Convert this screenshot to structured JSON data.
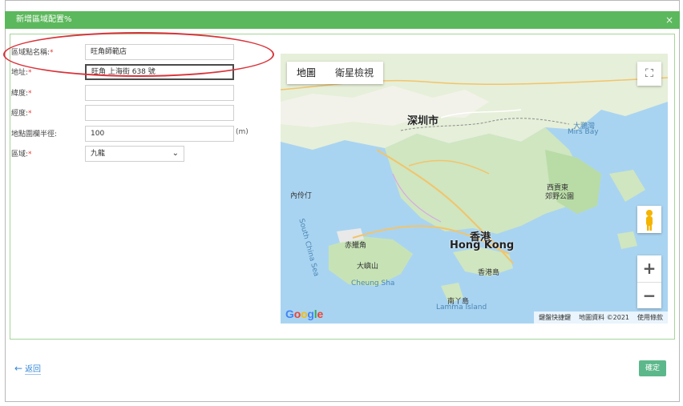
{
  "dialog": {
    "title": "新增區域配置%",
    "close_symbol": "×"
  },
  "form": {
    "name": {
      "label": "區域點名稱:",
      "value": "旺角師範店"
    },
    "address": {
      "label": "地址:",
      "value": "旺角 上海街 638 號"
    },
    "longitude": {
      "label": "緯度:",
      "value": ""
    },
    "latitude": {
      "label": "經度:",
      "value": ""
    },
    "radius": {
      "label": "地點圍欄半徑:",
      "value": "100",
      "unit": "(m)"
    },
    "region": {
      "label": "區域:",
      "value": "九龍"
    },
    "required_mark": "*"
  },
  "map": {
    "type_map": "地圖",
    "type_satellite": "衛星檢視",
    "fullscreen_symbol": "⛶",
    "zoom_in": "+",
    "zoom_out": "−",
    "labels": {
      "shenzhen": "深圳市",
      "hongkong_cn": "香港",
      "hongkong_en": "Hong Kong",
      "lantau": "大嶼山",
      "chek_lap_kok": "赤鱲角",
      "lamma_cn": "南丫島",
      "lamma_en": "Lamma Island",
      "hk_island": "香港島",
      "sai_kung": "西貢東",
      "sai_kung_2": "郊野公園",
      "mirs_bay": "大鵬灣",
      "mirs_bay_en": "Mirs Bay",
      "south_china_sea": "South China Sea",
      "cheung_sha": "Cheung Sha",
      "yuen_island": "內伶仃"
    },
    "google": "Google",
    "attribution": [
      "鍵盤快捷鍵",
      "地圖資料 ©2021",
      "使用條款"
    ]
  },
  "footer": {
    "back_label": "返回",
    "back_arrow": "←",
    "confirm_label": "確定"
  },
  "colors": {
    "titlebar": "#5cb85c",
    "confirm": "#5cb88a",
    "highlight_oval": "#d9333a",
    "link": "#3a8ad8"
  }
}
